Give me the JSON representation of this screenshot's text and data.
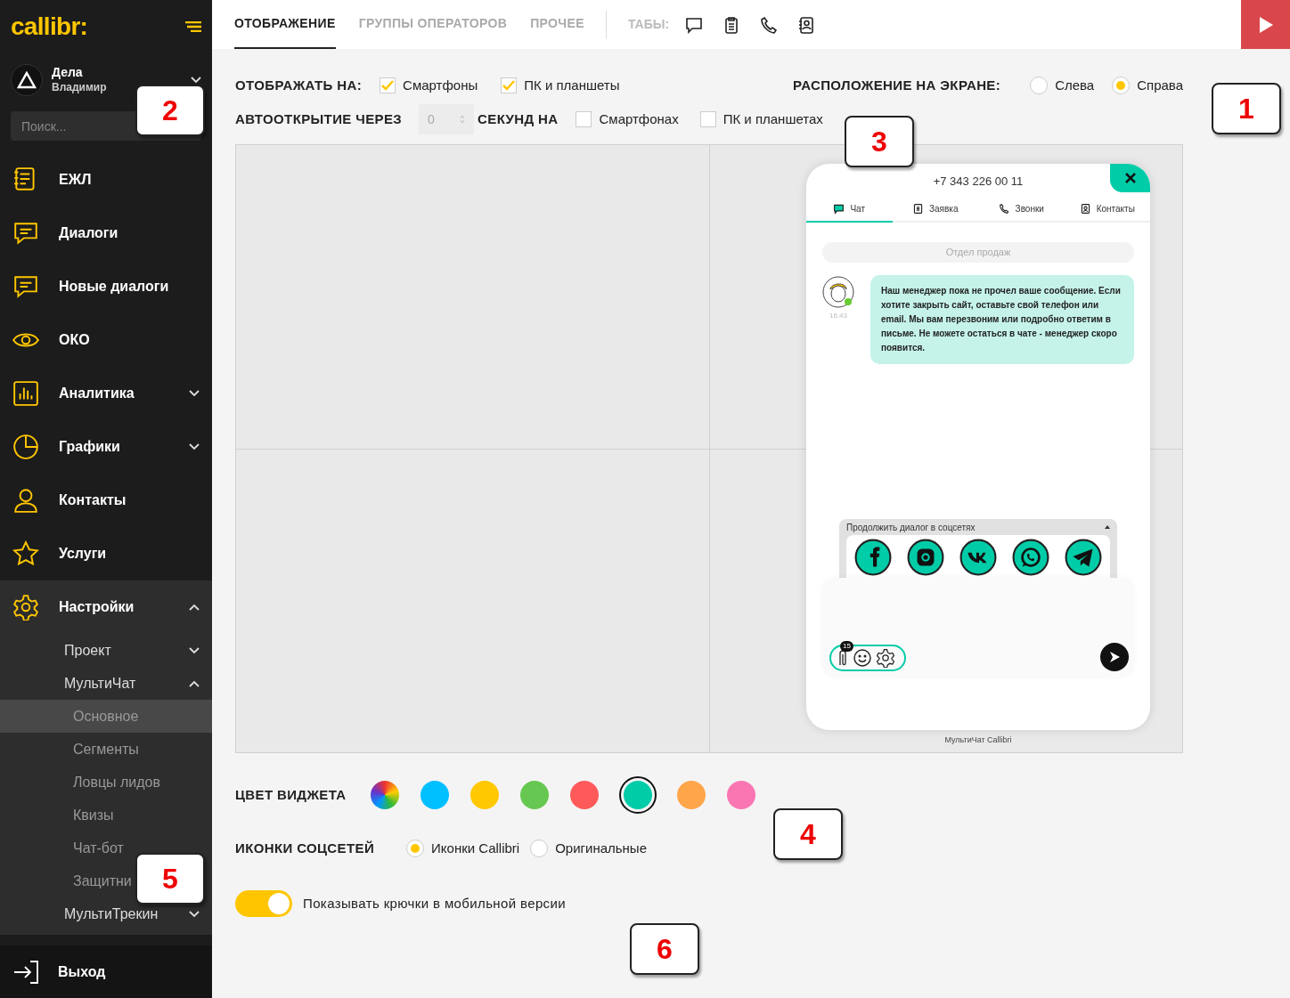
{
  "sidebar": {
    "logo": "callibr:",
    "account": {
      "name": "Дела",
      "user": "Владимир"
    },
    "search": {
      "placeholder": "Поиск..."
    },
    "items": [
      {
        "label": "ЕЖЛ",
        "expandable": false,
        "expanded": false
      },
      {
        "label": "Диалоги",
        "expandable": false,
        "expanded": false
      },
      {
        "label": "Новые диалоги",
        "expandable": false,
        "expanded": false
      },
      {
        "label": "ОКО",
        "expandable": false,
        "expanded": false
      },
      {
        "label": "Аналитика",
        "expandable": true,
        "expanded": false
      },
      {
        "label": "Графики",
        "expandable": true,
        "expanded": false
      },
      {
        "label": "Контакты",
        "expandable": false,
        "expanded": false
      },
      {
        "label": "Услуги",
        "expandable": false,
        "expanded": false
      },
      {
        "label": "Настройки",
        "expandable": true,
        "expanded": true,
        "children": [
          {
            "label": "Проект",
            "expandable": true,
            "expanded": false
          },
          {
            "label": "МультиЧат",
            "expandable": true,
            "expanded": true,
            "children": [
              {
                "label": "Основное",
                "selected": true
              },
              {
                "label": "Сегменты",
                "selected": false
              },
              {
                "label": "Ловцы лидов",
                "selected": false
              },
              {
                "label": "Квизы",
                "selected": false
              },
              {
                "label": "Чат-бот",
                "selected": false
              },
              {
                "label": "Защитни",
                "selected": false
              }
            ]
          },
          {
            "label": "МультиТрекин",
            "expandable": true,
            "expanded": false
          }
        ]
      }
    ],
    "logout": "Выход"
  },
  "tabs": [
    {
      "label": "ОТОБРАЖЕНИЕ",
      "selected": true
    },
    {
      "label": "ГРУППЫ ОПЕРАТОРОВ",
      "selected": false
    },
    {
      "label": "ПРОЧЕЕ",
      "selected": false
    }
  ],
  "tab_icons_label": "ТАБЫ:",
  "display": {
    "label": "ОТОБРАЖАТЬ НА:",
    "options": [
      {
        "label": "Смартфоны",
        "checked": true
      },
      {
        "label": "ПК и планшеты",
        "checked": true
      }
    ]
  },
  "position": {
    "label": "РАСПОЛОЖЕНИЕ НА ЭКРАНЕ:",
    "options": [
      {
        "label": "Слева",
        "selected": false
      },
      {
        "label": "Справа",
        "selected": true
      }
    ]
  },
  "autoopen": {
    "label": "АВТООТКРЫТИЕ ЧЕРЕЗ",
    "value": "0",
    "label_after": "СЕКУНД НА",
    "options": [
      {
        "label": "Смартфонах",
        "checked": false
      },
      {
        "label": "ПК и планшетах",
        "checked": false
      }
    ]
  },
  "widget": {
    "phone": "+7 343 226 00 11",
    "tabs": [
      {
        "label": "Чат",
        "selected": true
      },
      {
        "label": "Заявка",
        "selected": false
      },
      {
        "label": "Звонки",
        "selected": false
      },
      {
        "label": "Контакты",
        "selected": false
      }
    ],
    "department": "Отдел продаж",
    "time": "16:43",
    "message": "Наш менеджер пока не прочел ваше сообщение. Если хотите закрыть сайт, оставьте свой телефон или email. Мы вам перезвоним или подробно ответим в письме. Не можете остаться в чате - менеджер скоро появится.",
    "social_title": "Продолжить диалог в соцсетях",
    "attach_count": "15",
    "footer": "МультиЧат Callibri"
  },
  "colors": {
    "label": "ЦВЕТ ВИДЖЕТА",
    "swatches": [
      {
        "kind": "gradient",
        "selected": false
      },
      {
        "kind": "solid",
        "color": "#00bfff",
        "selected": false
      },
      {
        "kind": "solid",
        "color": "#ffc800",
        "selected": false
      },
      {
        "kind": "solid",
        "color": "#66c850",
        "selected": false
      },
      {
        "kind": "solid",
        "color": "#ff5a5a",
        "selected": false
      },
      {
        "kind": "solid",
        "color": "#00cca8",
        "selected": true
      },
      {
        "kind": "solid",
        "color": "#ffa54a",
        "selected": false
      },
      {
        "kind": "solid",
        "color": "#f976b2",
        "selected": false
      }
    ]
  },
  "social_icons": {
    "label": "ИКОНКИ СОЦСЕТЕЙ",
    "options": [
      {
        "label": "Иконки Callibri",
        "selected": true
      },
      {
        "label": "Оригинальные",
        "selected": false
      }
    ]
  },
  "hooks_toggle": {
    "label": "Показывать крючки в мобильной версии",
    "on": true
  },
  "callouts": [
    "1",
    "2",
    "3",
    "4",
    "5",
    "6"
  ]
}
